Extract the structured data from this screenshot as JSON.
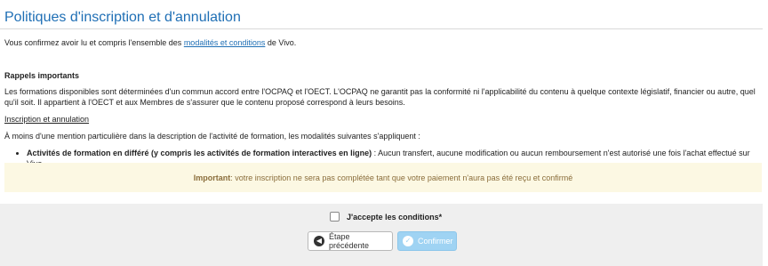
{
  "page": {
    "title": "Politiques d'inscription et d'annulation"
  },
  "confirm": {
    "before": "Vous confirmez avoir lu et compris l'ensemble des ",
    "link": "modalités et conditions",
    "after": " de Vivo."
  },
  "reminders": {
    "title": "Rappels importants",
    "paragraph": "Les formations disponibles sont déterminées d'un commun accord entre l'OCPAQ et l'OECT. L'OCPAQ ne garantit pas la conformité ni l'applicabilité du contenu à quelque contexte législatif, financier ou autre, quel qu'il soit. Il appartient à l'OECT et aux Membres de s'assurer que le contenu proposé correspond à leurs besoins."
  },
  "registration": {
    "title": "Inscription et annulation",
    "intro": "À moins d'une mention particulière dans la description de l'activité de formation, les modalités suivantes s'appliquent :",
    "bullets": [
      {
        "bold": "Activités de formation en différé (y compris les activités de formation interactives en ligne)",
        "text": ": Aucun transfert, aucune modification ou aucun remboursement n'est autorisé une fois l'achat effectué sur Vivo."
      }
    ]
  },
  "notice": {
    "bold": "Important",
    "text": ": votre inscription ne sera pas complétée tant que votre paiement n'aura pas été reçu et confirmé"
  },
  "footer": {
    "accept_label": "J'accepte les conditions*",
    "prev_label": "Étape précédente",
    "confirm_label": "Confirmer",
    "confirm_enabled": false
  },
  "icons": {
    "prev": "arrow-left-circle-icon",
    "confirm": "check-circle-icon"
  },
  "colors": {
    "title": "#1f6fb5",
    "link": "#1f6fb5",
    "notice_bg": "#fcf8e3",
    "notice_text": "#8a6d3b",
    "confirm_button": "#9fd3f3"
  }
}
